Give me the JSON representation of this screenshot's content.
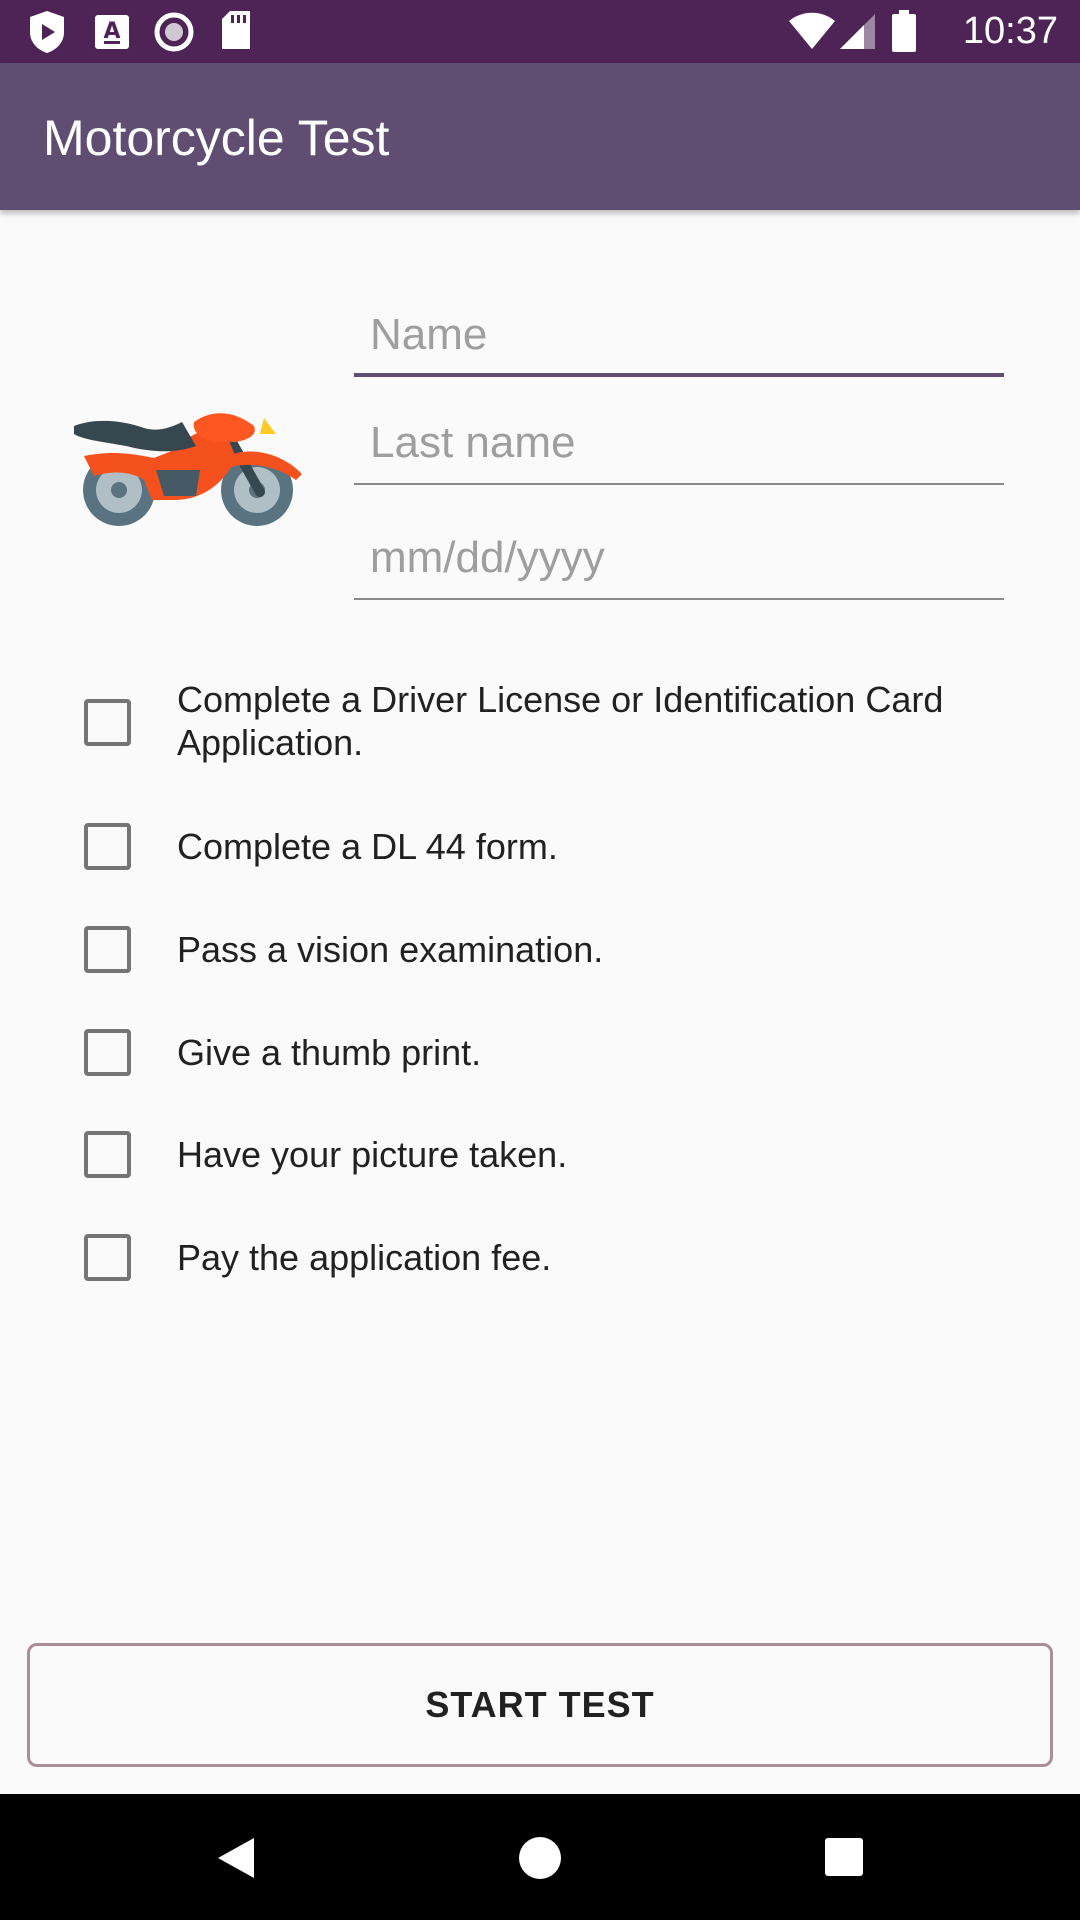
{
  "status_bar": {
    "time": "10:37",
    "icons_left": [
      "shield-play-icon",
      "font-icon",
      "record-icon",
      "sd-card-icon"
    ],
    "icons_right": [
      "wifi-icon",
      "cell-signal-icon",
      "battery-icon"
    ]
  },
  "app_bar": {
    "title": "Motorcycle Test"
  },
  "hero": {
    "icon": "motorcycle-icon"
  },
  "form": {
    "name": {
      "value": "",
      "placeholder": "Name"
    },
    "last_name": {
      "value": "",
      "placeholder": "Last name"
    },
    "date": {
      "value": "",
      "placeholder": "mm/dd/yyyy"
    }
  },
  "checklist": [
    {
      "label": "Complete a Driver License or Identification Card Application.",
      "checked": false
    },
    {
      "label": "Complete a DL 44 form.",
      "checked": false
    },
    {
      "label": "Pass a vision examination.",
      "checked": false
    },
    {
      "label": "Give a thumb print.",
      "checked": false
    },
    {
      "label": "Have your picture taken.",
      "checked": false
    },
    {
      "label": "Pay the application fee.",
      "checked": false
    }
  ],
  "actions": {
    "start_label": "START TEST"
  },
  "nav_bar": {
    "buttons": [
      "back-icon",
      "home-icon",
      "recents-icon"
    ]
  },
  "colors": {
    "status_bar": "#4e2457",
    "app_bar": "#604d72",
    "background": "#fafafa",
    "accent": "#604d72"
  }
}
